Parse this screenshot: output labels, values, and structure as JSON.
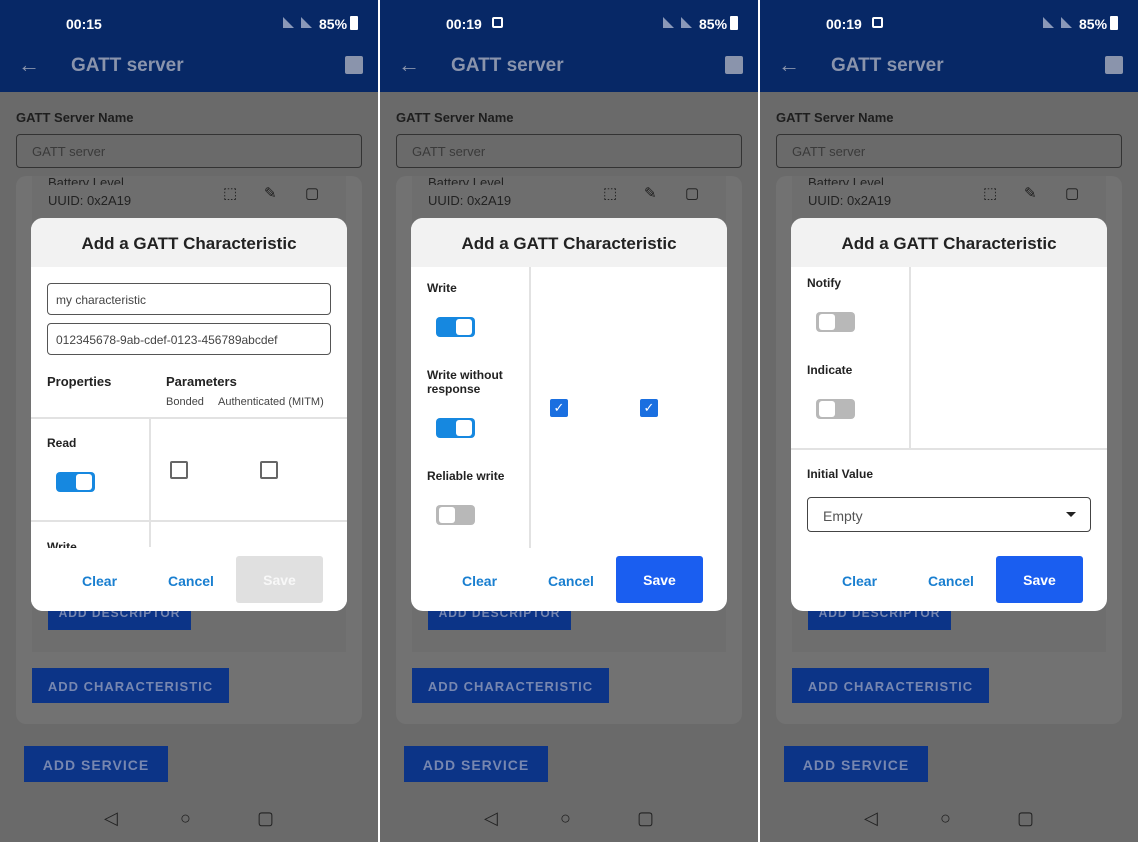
{
  "common": {
    "app_title": "GATT server",
    "battery": "85%",
    "server_name_label": "GATT Server Name",
    "server_name_value": "GATT server",
    "service_item": "Battery Level",
    "service_uuid": "UUID:  0x2A19",
    "add_descriptor": "ADD DESCRIPTOR",
    "add_characteristic": "ADD CHARACTERISTIC",
    "add_service": "ADD SERVICE",
    "dialog_title": "Add a GATT Characteristic",
    "clear": "Clear",
    "cancel": "Cancel",
    "save": "Save"
  },
  "screens": [
    {
      "time": "00:15",
      "image_notification": false,
      "dialog": {
        "name_value": "my characteristic",
        "uuid_value": "012345678-9ab-cdef-0123-456789abcdef",
        "properties_header": "Properties",
        "parameters_header": "Parameters",
        "bonded": "Bonded",
        "authenticated": "Authenticated (MITM)",
        "read_label": "Read",
        "read_on": true,
        "read_bonded": false,
        "read_mitm": false,
        "write_label": "Write",
        "save_enabled": false
      }
    },
    {
      "time": "00:19",
      "image_notification": true,
      "dialog": {
        "write_label": "Write",
        "write_on": true,
        "write_nr_label": "Write without response",
        "write_nr_on": true,
        "write_bonded": true,
        "write_mitm": true,
        "reliable_label": "Reliable write",
        "reliable_on": false,
        "save_enabled": true
      }
    },
    {
      "time": "00:19",
      "image_notification": true,
      "dialog": {
        "notify_label": "Notify",
        "notify_on": false,
        "indicate_label": "Indicate",
        "indicate_on": false,
        "initial_value_label": "Initial Value",
        "initial_value": "Empty",
        "save_enabled": true
      }
    }
  ],
  "colors": {
    "appbar": "#072866",
    "accent": "#1a5ef0",
    "switch_on": "#1688e0",
    "link": "#1a7fd0"
  }
}
